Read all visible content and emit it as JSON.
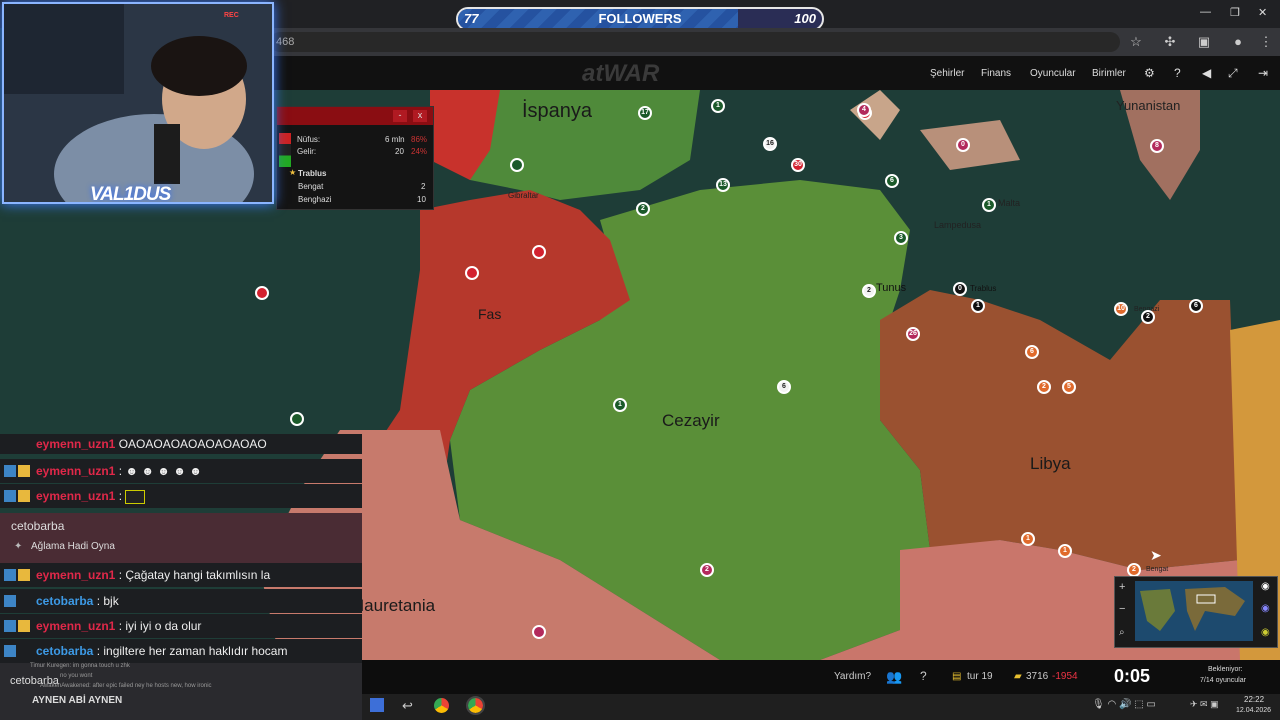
{
  "overlay": {
    "followers_current": "77",
    "followers_label": "FOLLOWERS",
    "followers_goal": "100",
    "followers_progress": 0.77,
    "streamer_name": "VAL1DUS",
    "rec_label": "REC"
  },
  "browser": {
    "url_fragment": "468"
  },
  "game": {
    "logo": "atWAR",
    "nav": [
      "Şehirler",
      "Finans",
      "Oyuncular",
      "Birimler"
    ],
    "regions": [
      "İspanya",
      "Fas",
      "Cezayir",
      "Libya",
      "Mauretania",
      "Yunanistan"
    ],
    "cities": [
      "Gibraltar",
      "Lampedusa",
      "Malta",
      "Tunus",
      "Trablus",
      "Bengazi",
      "Bengat"
    ],
    "city_numbers": [
      "17",
      "1",
      "16",
      "30",
      "4",
      "0",
      "8",
      "13",
      "2",
      "6",
      "3",
      "1",
      "4",
      "0",
      "1",
      "2",
      "6",
      "26",
      "6",
      "2",
      "5",
      "10",
      "2",
      "6",
      "1",
      "1",
      "1",
      "2",
      "2"
    ],
    "help_label": "Yardım?",
    "turn_label": "tur 19",
    "money_value": "3716",
    "money_delta": "-1954",
    "timer": "0:05",
    "waiting_label": "Bekleniyor:",
    "players_waiting": "7/14 oyuncular"
  },
  "info_popup": {
    "population_label": "Nüfus:",
    "population_value": "6 mln",
    "population_pct": "86%",
    "income_label": "Gelir:",
    "income_value": "20",
    "income_pct": "24%",
    "capital": "Trablus",
    "cities": [
      {
        "name": "Bengat",
        "value": "2"
      },
      {
        "name": "Benghazi",
        "value": "10"
      }
    ]
  },
  "chat": {
    "messages": [
      {
        "user": "eymenn_uzn1",
        "text": "OAOAOAOAOAOAOAOAO",
        "color": "#e02849"
      },
      {
        "user": "eymenn_uzn1",
        "text": ": ☻ ☻ ☻ ☻ ☻",
        "color": "#e02849"
      },
      {
        "user": "eymenn_uzn1",
        "text": ":",
        "color": "#e02849"
      },
      {
        "user": "eymenn_uzn1",
        "text": ": Çağatay hangi takımlısın la",
        "color": "#e02849"
      },
      {
        "user": "cetobarba",
        "text": ": bjk",
        "color": "#3d9ae6"
      },
      {
        "user": "eymenn_uzn1",
        "text": ": iyi iyi o da olur",
        "color": "#e02849"
      },
      {
        "user": "cetobarba",
        "text": ": ingiltere her zaman haklıdır hocam",
        "color": "#3d9ae6"
      }
    ],
    "donation_user": "cetobarba",
    "donation_text": "Ağlama Hadi Oyna",
    "mini_line_1": "Timur Kuregen: im gonna touch u zhk",
    "mini_line_2": "no you wont",
    "mini_line_3": "AwakenAwakened: after epic failed ney he hosts new, how ironic",
    "bottom_user": "cetobarba",
    "bottom_text": "AYNEN ABİ AYNEN"
  },
  "clock": {
    "time": "22:22",
    "date": "12.04.2026"
  }
}
